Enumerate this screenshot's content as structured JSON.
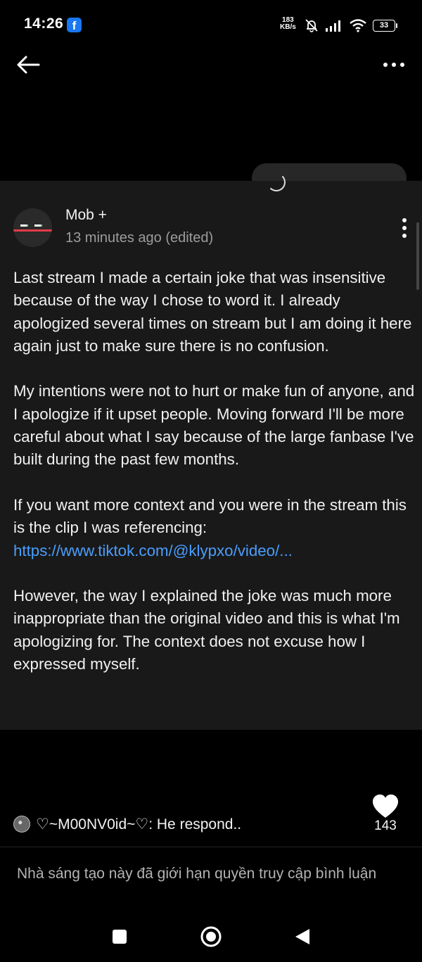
{
  "status_bar": {
    "time": "14:26",
    "app_icon": "facebook-icon",
    "network_speed_value": "183",
    "network_speed_unit": "KB/s",
    "icons": [
      "silent-bell-icon",
      "signal-icon",
      "wifi-icon"
    ],
    "battery": "33"
  },
  "top_bar": {
    "back_icon": "arrow-left-icon",
    "more_icon": "more-horizontal-icon"
  },
  "post": {
    "author": "Mob +",
    "timestamp": "13 minutes ago (edited)",
    "paragraphs": [
      "Last stream I made a certain joke that was insensitive because of the way I chose to word it. I already apologized several times on stream but I am doing it here again just to make sure there is no confusion.",
      "My intentions were not to hurt or make fun of anyone, and I apologize if it upset people. Moving forward I'll be more careful about what I say because of the large fanbase I've built during the past few months.",
      "If you want more context and you were in the stream this is the clip I was referencing: ",
      "However, the way I explained the joke was much more inappropriate than the original video and this is what I'm apologizing for. The context does not excuse how I expressed myself."
    ],
    "link_text": "https://www.tiktok.com/@klypxo/video/..."
  },
  "comment_preview": {
    "text": "♡~M00NV0id~♡: He respond.."
  },
  "likes": {
    "count": "143"
  },
  "notice": "Nhà sáng tạo này đã giới hạn quyền truy cập bình luận",
  "colors": {
    "background": "#000000",
    "card": "#191919",
    "link": "#4a9eff",
    "facebook": "#1877f2"
  }
}
